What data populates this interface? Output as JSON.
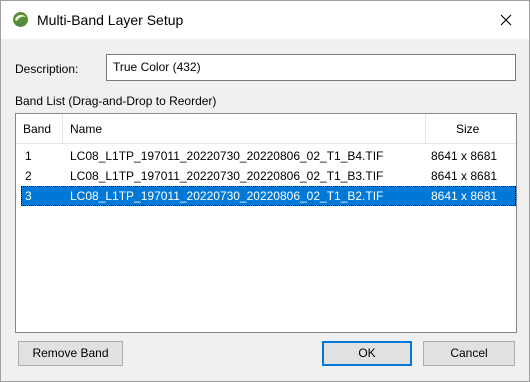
{
  "window": {
    "title": "Multi-Band Layer Setup",
    "icon": "app-globe-icon",
    "close_icon": "close-icon"
  },
  "description": {
    "label": "Description:",
    "value": "True Color (432)"
  },
  "band_list": {
    "label": "Band List (Drag-and-Drop to Reorder)",
    "columns": [
      "Band",
      "Name",
      "Size"
    ],
    "rows": [
      {
        "band": "1",
        "name": "LC08_L1TP_197011_20220730_20220806_02_T1_B4.TIF",
        "size": "8641 x 8681",
        "selected": false
      },
      {
        "band": "2",
        "name": "LC08_L1TP_197011_20220730_20220806_02_T1_B3.TIF",
        "size": "8641 x 8681",
        "selected": false
      },
      {
        "band": "3",
        "name": "LC08_L1TP_197011_20220730_20220806_02_T1_B2.TIF",
        "size": "8641 x 8681",
        "selected": true
      }
    ]
  },
  "buttons": {
    "remove": "Remove Band",
    "ok": "OK",
    "cancel": "Cancel"
  },
  "colors": {
    "selection": "#0078d7",
    "dialog_bg": "#f0f0f0"
  }
}
